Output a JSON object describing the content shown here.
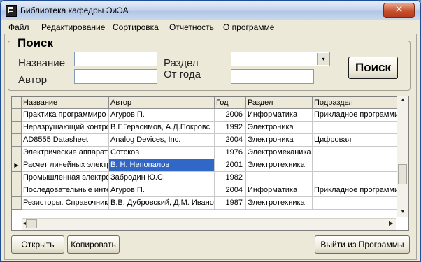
{
  "window": {
    "title": "Библиотека кафедры ЭиЭА",
    "close_glyph": "✕"
  },
  "menu": [
    "Файл",
    "Редактирование",
    "Сортировка",
    "Отчетность",
    "О программе"
  ],
  "search": {
    "title": "Поиск",
    "name_label": "Название",
    "author_label": "Автор",
    "section_label": "Раздел",
    "year_label": "От года",
    "name_value": "",
    "author_value": "",
    "section_value": "",
    "year_value": "",
    "dropdown_glyph": "▾",
    "button": "Поиск"
  },
  "grid": {
    "columns": [
      "Название",
      "Автор",
      "Год",
      "Раздел",
      "Подраздел"
    ],
    "selected_row": 4,
    "row_marker": "▶",
    "rows": [
      [
        "Практика программиро",
        "Агуров П.",
        "2006",
        "Информатика",
        "Прикладное программи"
      ],
      [
        "Неразрушающий контро",
        "В.Г.Герасимов, А.Д.Покровс",
        "1992",
        "Электроника",
        ""
      ],
      [
        "AD8555 Datasheet",
        "Analog Devices, Inc.",
        "2004",
        "Электроника",
        "Цифровая"
      ],
      [
        "Электрические аппарат",
        "Сотсков",
        "1976",
        "Электромеханика",
        ""
      ],
      [
        "Расчет линейных электр",
        "В. Н. Непопалов",
        "2001",
        "Электротехника",
        ""
      ],
      [
        "Промышленная электро",
        "Забродин Ю.С.",
        "1982",
        "",
        ""
      ],
      [
        "Последовательные инте",
        "Агуров П.",
        "2004",
        "Информатика",
        "Прикладное программи"
      ],
      [
        "Резисторы. Справочник",
        "В.В. Дубровский, Д.М. Ивано",
        "1987",
        "Электротехника",
        ""
      ]
    ]
  },
  "buttons": {
    "open": "Открыть",
    "copy": "Копировать",
    "exit": "Выйти из Программы"
  }
}
